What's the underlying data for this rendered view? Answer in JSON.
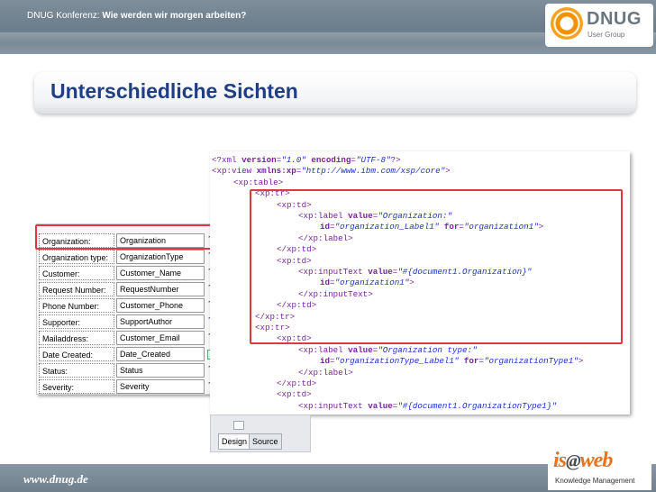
{
  "header": {
    "prefix": "DNUG Konferenz: ",
    "subtitle": "Wie werden wir morgen arbeiten?"
  },
  "logo": {
    "name": "DNUG",
    "tagline": "User Group"
  },
  "slide_title": "Unterschiedliche Sichten",
  "form": {
    "rows": [
      {
        "label": "Organization:",
        "field": "Organization",
        "icon": "T"
      },
      {
        "label": "Organization type:",
        "field": "OrganizationType",
        "icon": "T"
      },
      {
        "label": "Customer:",
        "field": "Customer_Name",
        "icon": "T"
      },
      {
        "label": "Request Number:",
        "field": "RequestNumber",
        "icon": "T"
      },
      {
        "label": "Phone Number:",
        "field": "Customer_Phone",
        "icon": "T"
      },
      {
        "label": "Supporter:",
        "field": "SupportAuthor",
        "icon": "T"
      },
      {
        "label": "Mailaddress:",
        "field": "Customer_Email",
        "icon": "T"
      },
      {
        "label": "Date Created:",
        "field": "Date_Created",
        "icon": "calendar-icon"
      },
      {
        "label": "Status:",
        "field": "Status",
        "icon": "T"
      },
      {
        "label": "Severity:",
        "field": "Severity",
        "icon": "T"
      }
    ]
  },
  "code": {
    "lines": [
      "<?xml version=\"1.0\" encoding=\"UTF-8\"?>",
      "<xp:view xmlns:xp=\"http://www.ibm.com/xsp/core\">",
      "<xp:table>",
      "<xp:tr>",
      "<xp:td>",
      "<xp:label value=\"Organization:\"",
      "id=\"organization_Label1\" for=\"organization1\">",
      "</xp:label>",
      "</xp:td>",
      "<xp:td>",
      "<xp:inputText value=\"#{document1.Organization}\"",
      "id=\"organization1\">",
      "</xp:inputText>",
      "</xp:td>",
      "</xp:tr>",
      "<xp:tr>",
      "<xp:td>",
      "<xp:label value=\"Organization type:\"",
      "id=\"organizationType_Label1\" for=\"organizationType1\">",
      "</xp:label>",
      "</xp:td>",
      "<xp:td>",
      "<xp:inputText value=\"#{document1.OrganizationType1}\""
    ]
  },
  "editor_tabs": {
    "design": "Design",
    "source": "Source"
  },
  "footer": {
    "url": "www.dnug.de"
  },
  "sponsor": {
    "brand_pre": "is",
    "brand_at": "@",
    "brand_post": "web",
    "tagline": "Knowledge Management"
  },
  "colors": {
    "highlight": "#e0383c",
    "title": "#1f3e86",
    "band": "#7f8e9a"
  }
}
